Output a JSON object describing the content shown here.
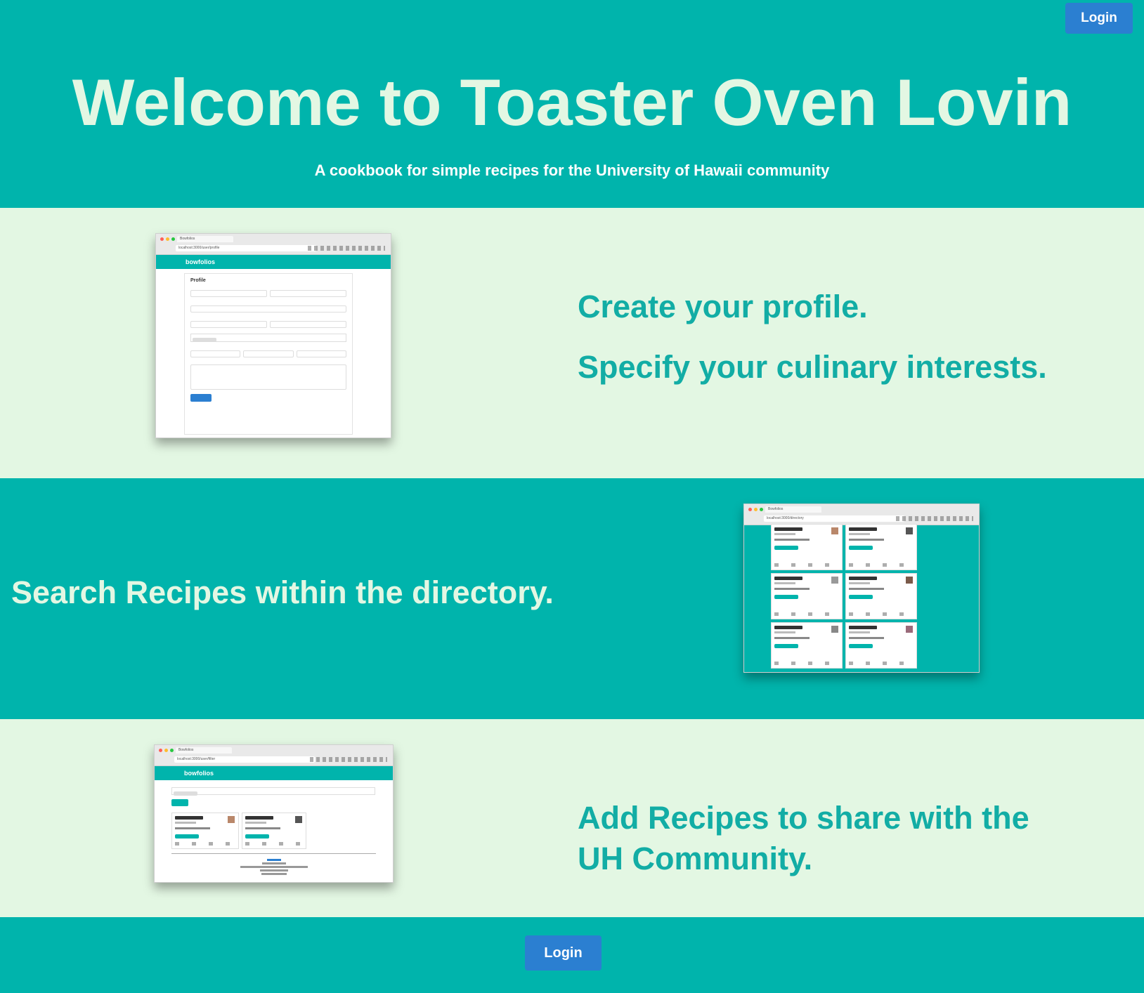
{
  "header": {
    "login_label": "Login",
    "title": "Welcome to Toaster Oven Lovin",
    "subtitle": "A cookbook for simple recipes for the University of Hawaii community"
  },
  "features": [
    {
      "lines": [
        "Create your profile.",
        "Specify your culinary interests."
      ],
      "screenshot": {
        "app_name": "bowfolios",
        "url": "localhost:3000/user/profile",
        "tab_title": "Bowfolios",
        "form_title": "Profile"
      }
    },
    {
      "lines": [
        "Search Recipes within the directory."
      ],
      "screenshot": {
        "url": "localhost:3000/directory",
        "tab_title": "Bowfolios"
      }
    },
    {
      "lines": [
        "Add Recipes to share with the UH Community."
      ],
      "screenshot": {
        "app_name": "bowfolios",
        "url": "localhost:3000/user/filter",
        "tab_title": "Bowfolios"
      }
    }
  ],
  "footer": {
    "login_label": "Login"
  },
  "colors": {
    "teal": "#00b4ac",
    "light_green": "#e3f7e3",
    "button_blue": "#2b7fd1",
    "feature_text_teal": "#12ada5"
  }
}
